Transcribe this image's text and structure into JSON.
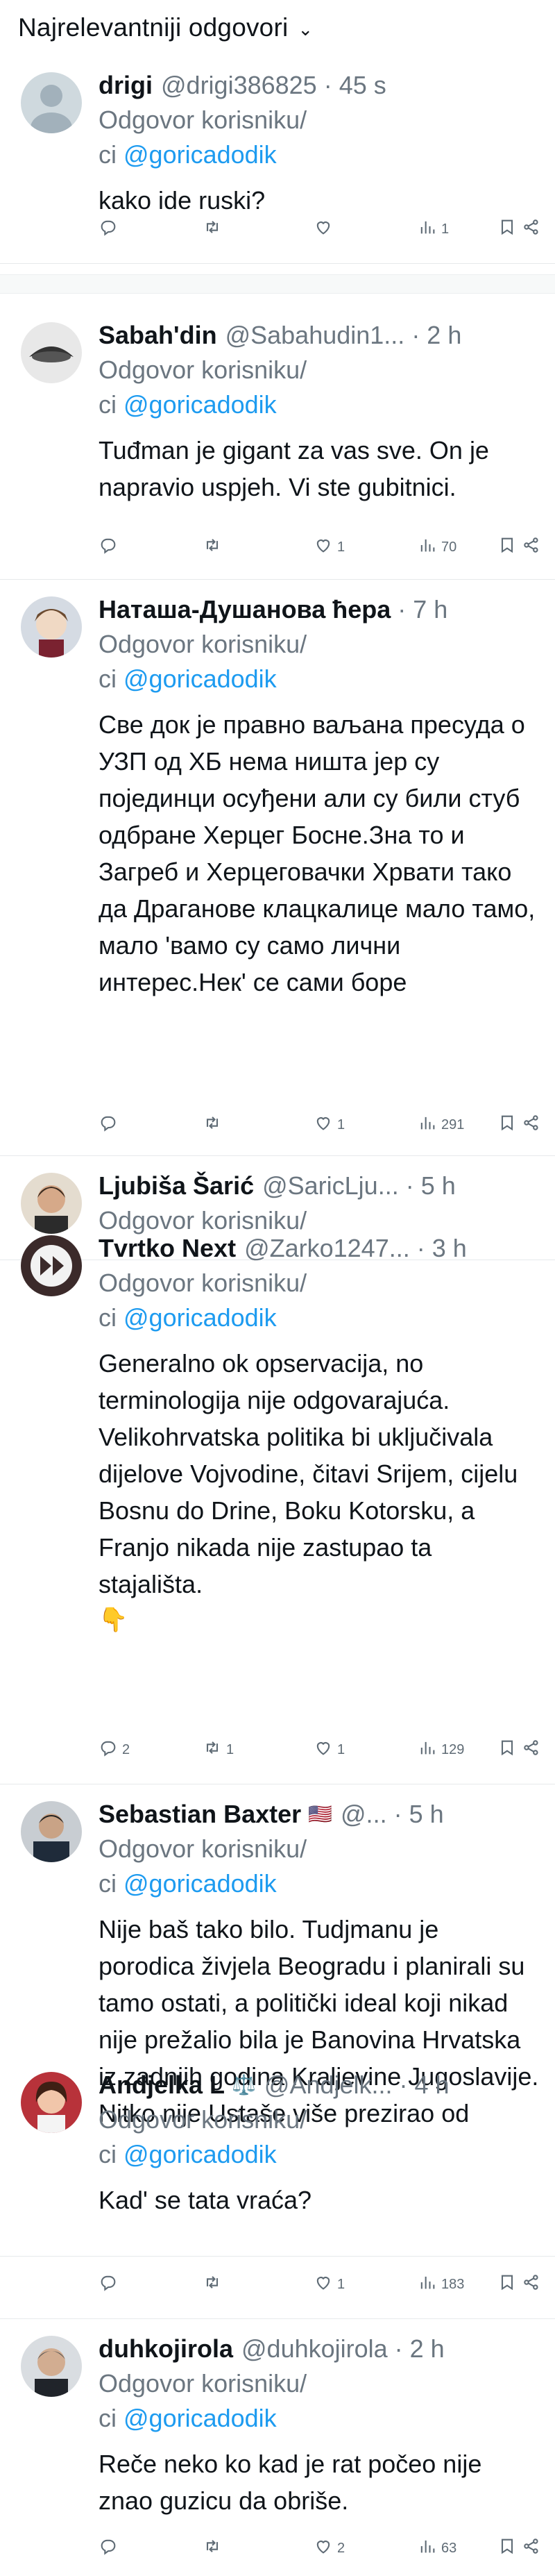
{
  "header": {
    "title": "Najrelevantniji odgovori",
    "chevron": "⌄"
  },
  "reply_prefix": "Odgovor korisniku/",
  "reply_prefix2": "ci ",
  "mention": "@goricadodik",
  "tweets": [
    {
      "name": "drigi",
      "handle": "@drigi386825",
      "time": "· 45 s",
      "show_reply_to": true,
      "text": "kako ide ruski?",
      "counts": {
        "reply": "",
        "retweet": "",
        "like": "",
        "views": "1"
      }
    },
    {
      "name": "Sabah'din",
      "handle": "@Sabahudin1...",
      "time": "· 2 h",
      "show_reply_to": true,
      "text": "Tuđman je gigant za vas sve. On je napravio uspjeh. Vi ste gubitnici.",
      "counts": {
        "reply": "",
        "retweet": "",
        "like": "1",
        "views": "70"
      }
    },
    {
      "name": "Наташа-Душанова ћера",
      "handle": "",
      "time": "· 7 h",
      "show_reply_to": true,
      "text": "Све док је правно ваљана пресуда о УЗП од ХБ нема ништа јер су појединци осуђени али су били стуб одбране Херцег Босне.Зна то и Загреб и Херцеговачки Хрвати тако да Драганове клацкалице мало тамо, мало 'вамо су само лични интерес.Нек' се сами боре",
      "counts": {
        "reply": "",
        "retweet": "",
        "like": "1",
        "views": "291"
      }
    },
    {
      "name": "Ljubiša Šarić",
      "handle": "@SaricLju...",
      "time": "· 5 h",
      "show_reply_to": false,
      "reply_only": "Odgovor korisniku/",
      "text": "",
      "counts": null
    },
    {
      "name": "Tvrtko Next",
      "handle": "@Zarko1247...",
      "time": "· 3 h",
      "show_reply_to": true,
      "text": "Generalno ok opservacija, no terminologija nije odgovarajuća. Velikohrvatska politika bi uključivala dijelove Vojvodine, čitavi Srijem, cijelu Bosnu do Drine, Boku Kotorsku, a Franjo nikada nije zastupao ta stajališta.",
      "emoji": "👇",
      "counts": {
        "reply": "2",
        "retweet": "1",
        "like": "1",
        "views": "129"
      }
    },
    {
      "name": "Sebastian Baxter",
      "badge": "🇺🇸",
      "handle": "@...",
      "time": "· 5 h",
      "show_reply_to": true,
      "text": "Nije baš tako bilo. Tudjmanu je porodica živjela  Beogradu i planirali su tamo ostati, a politički ideal koji nikad nije prežalio bila je Banovina Hrvatska iz zadnjih godina Kraljevine Jugoslavije. Nitko nije Ustaše više prezirao od",
      "counts": null
    },
    {
      "name": "Andjelka L",
      "badge": "⚖️",
      "handle": "@Andjelk...",
      "time": "· 4 h",
      "show_reply_to": true,
      "text": "Kad' se tata vraća?",
      "counts": {
        "reply": "",
        "retweet": "",
        "like": "1",
        "views": "183"
      }
    },
    {
      "name": "duhkojirola",
      "handle": "@duhkojirola",
      "time": "· 2 h",
      "show_reply_to": true,
      "text": "Reče neko ko kad je rat počeo nije znao guzicu da obriše.",
      "counts": {
        "reply": "",
        "retweet": "",
        "like": "2",
        "views": "63"
      }
    }
  ],
  "icons": [
    "reply-icon",
    "retweet-icon",
    "like-icon",
    "views-icon",
    "bookmark-icon",
    "share-icon"
  ],
  "colors": {
    "mention": "#1d9bf0",
    "secondary": "#6b7680",
    "text": "#0f1419"
  }
}
